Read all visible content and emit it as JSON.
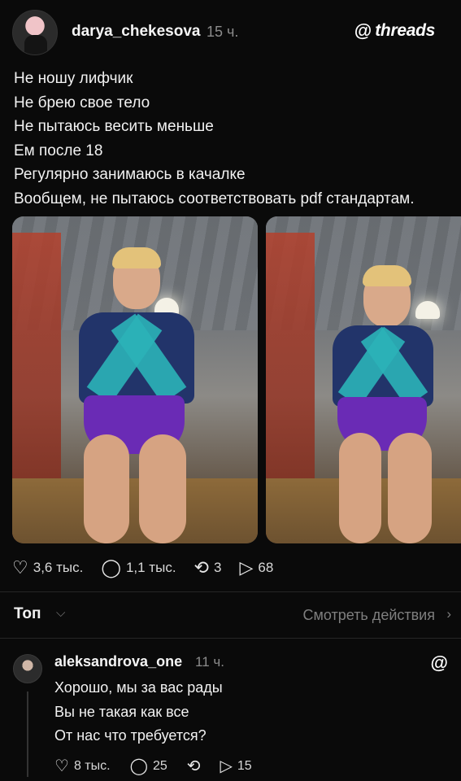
{
  "post": {
    "username": "darya_chekesova",
    "time": "15 ч.",
    "brand": {
      "icon": "threads-logo-icon",
      "text": "threads"
    },
    "lines": [
      "Не ношу лифчик",
      "Не брею свое тело",
      "Не пытаюсь весить меньше",
      "Ем после 18",
      "Регулярно занимаюсь в качалке",
      "Вообщем, не пытаюсь соответствовать pdf стандартам."
    ],
    "media_count": 2,
    "actions": {
      "likes": "3,6 тыс.",
      "replies": "1,1 тыс.",
      "reposts": "3",
      "shares": "68"
    }
  },
  "comments_header": {
    "sort_label": "Топ",
    "view_activity": "Смотреть действия"
  },
  "comment": {
    "username": "aleksandrova_one",
    "time": "11 ч.",
    "lines": [
      "Хорошо, мы за вас рады",
      "Вы не такая как все",
      "От нас что требуется?"
    ],
    "actions": {
      "likes": "8 тыс.",
      "replies": "25",
      "shares": "15"
    }
  },
  "icons": {
    "heart": "heart-icon",
    "reply": "reply-icon",
    "repost": "repost-icon",
    "share": "share-icon"
  }
}
